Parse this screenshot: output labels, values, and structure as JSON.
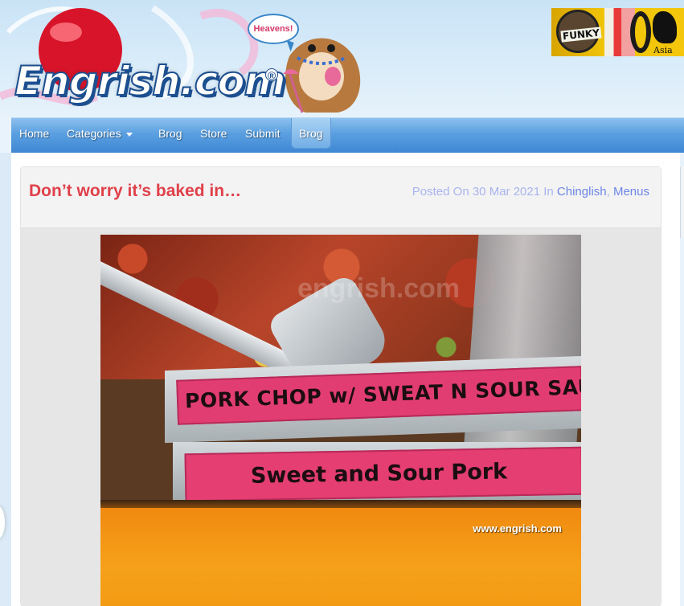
{
  "site": {
    "logo_text": "Engrish.com",
    "logo_reg": "®",
    "bubble_text": "Heavens!"
  },
  "ad": {
    "funky_text": "FUNKY",
    "asia_text": "Asia"
  },
  "nav": {
    "items": [
      {
        "label": "Home"
      },
      {
        "label": "Categories",
        "has_dropdown": true
      },
      {
        "label": "Brog"
      },
      {
        "label": "Store"
      },
      {
        "label": "Submit"
      },
      {
        "label": "Brog",
        "active": true
      }
    ]
  },
  "post": {
    "title": "Don’t worry it’s baked in…",
    "meta_prefix": "Posted On 30 Mar 2021 In",
    "category_1": "Chinglish",
    "category_sep": ",",
    "category_2": "Menus"
  },
  "photo": {
    "sign_1": "PORK CHOP w/ SWEAT N SOUR SAU",
    "sign_2": "Sweet and Sour Pork",
    "watermark_top": "engrish.com",
    "watermark_bottom": "www.engrish.com"
  },
  "colors": {
    "title": "#e0404a",
    "nav_blue": "#4a92da",
    "meta": "#a9b4ee",
    "sign_pink": "#e23d72"
  },
  "icons": {
    "dropdown": "caret-down-icon"
  }
}
